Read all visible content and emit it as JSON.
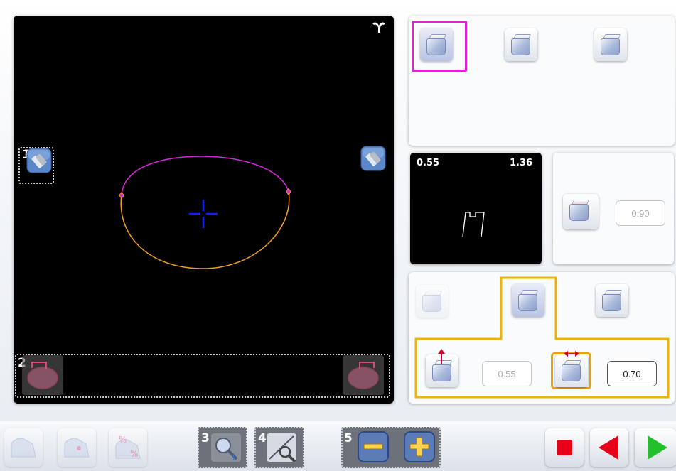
{
  "viewer": {
    "badge1": "1",
    "badge2": "2",
    "corner_icon": "lens-frame-icon",
    "icons": [
      "clip-icon",
      "left-lens-outline-icon",
      "right-lens-outline-icon",
      "crosshair-icon"
    ]
  },
  "profile": {
    "left_value": "0.55",
    "right_value": "1.36"
  },
  "bevel": {
    "value": "0.90"
  },
  "groove": {
    "depth_value": "0.55",
    "width_value": "0.70"
  },
  "toolbar": {
    "badge3": "3",
    "badge4": "4",
    "badge5": "5",
    "icons": [
      "edge-tool-icon",
      "polish-icon",
      "percent-icon",
      "lens-search-icon",
      "measure-icon",
      "minus-icon",
      "plus-icon",
      "stop-icon",
      "previous-icon",
      "next-icon"
    ]
  },
  "colors": {
    "highlight_magenta": "#e022d4",
    "highlight_orange": "#f0b400",
    "contour_upper": "#d62ad6",
    "contour_lower": "#f0a020",
    "crosshair": "#1020ff",
    "stop": "#e8001a",
    "prev": "#e8001a",
    "next": "#22c02a"
  }
}
